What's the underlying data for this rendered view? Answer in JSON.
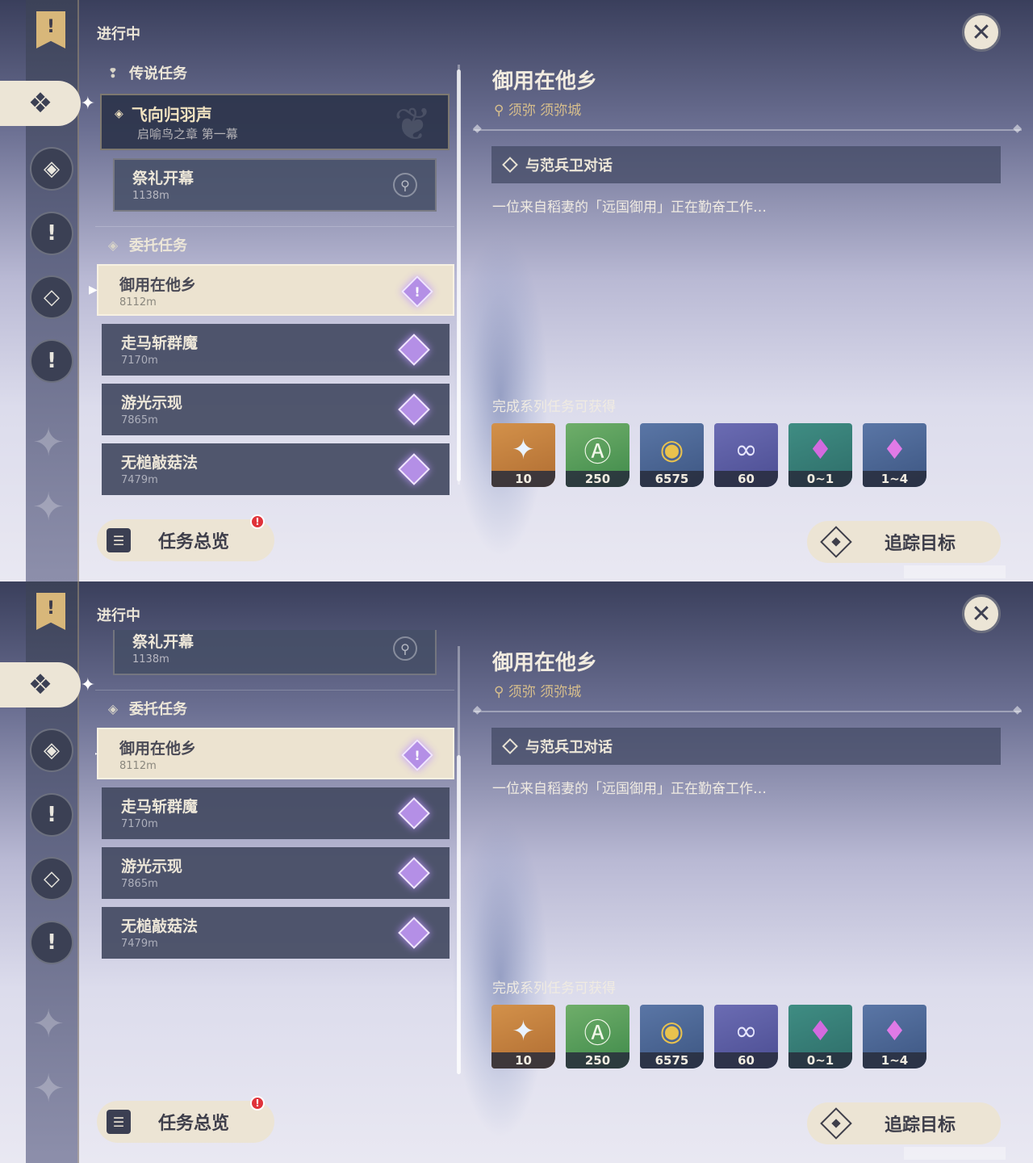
{
  "header": {
    "section": "进行中"
  },
  "close": {
    "glyph": "✕"
  },
  "rail": {
    "bookmark_glyph": "!",
    "active_glyph": "❖",
    "spark_glyph": "✦",
    "icons": [
      {
        "name": "legend-quest-icon",
        "glyph": "◈"
      },
      {
        "name": "world-quest-icon",
        "glyph": "!"
      },
      {
        "name": "commission-icon",
        "glyph": "◇"
      },
      {
        "name": "event-quest-icon",
        "glyph": "!"
      }
    ],
    "deco_glyph": "✦"
  },
  "categories": {
    "legend": {
      "icon": "❢",
      "label": "传说任务"
    },
    "commission": {
      "icon": "◈",
      "label": "委托任务"
    }
  },
  "legend_quest": {
    "title": "飞向归羽声",
    "subtitle": "启喻鸟之章 第一幕",
    "icon": "◈",
    "emblem": "❦",
    "step": {
      "title": "祭礼开幕",
      "distance": "1138m",
      "pin": "⚲"
    }
  },
  "quests": [
    {
      "title": "御用在他乡",
      "distance": "8112m",
      "selected": true,
      "mark": "!"
    },
    {
      "title": "走马斩群魔",
      "distance": "7170m",
      "selected": false,
      "mark": ""
    },
    {
      "title": "游光示现",
      "distance": "7865m",
      "selected": false,
      "mark": ""
    },
    {
      "title": "无槌敲菇法",
      "distance": "7479m",
      "selected": false,
      "mark": ""
    }
  ],
  "detail": {
    "title": "御用在他乡",
    "location": "须弥 须弥城",
    "location_icon": "⚲",
    "objective": "与范兵卫对话",
    "description": "一位来自稻妻的「远国御用」正在勤奋工作…",
    "rewards_title": "完成系列任务可获得",
    "rewards": [
      {
        "name": "primogem",
        "glyph": "✦",
        "count": "10",
        "color": "orange"
      },
      {
        "name": "adventure-exp",
        "glyph": "Ⓐ",
        "count": "250",
        "color": "green"
      },
      {
        "name": "mora",
        "glyph": "◉",
        "count": "6575",
        "color": "blue"
      },
      {
        "name": "companionship-exp",
        "glyph": "∞",
        "count": "60",
        "color": "purple"
      },
      {
        "name": "crystal-chunk",
        "glyph": "♦",
        "count": "0~1",
        "color": "teal"
      },
      {
        "name": "crystal-cluster",
        "glyph": "♦",
        "count": "1~4",
        "color": "blue"
      }
    ]
  },
  "buttons": {
    "overview": "任务总览",
    "overview_icon": "☰",
    "badge": "!",
    "track": "追踪目标"
  }
}
